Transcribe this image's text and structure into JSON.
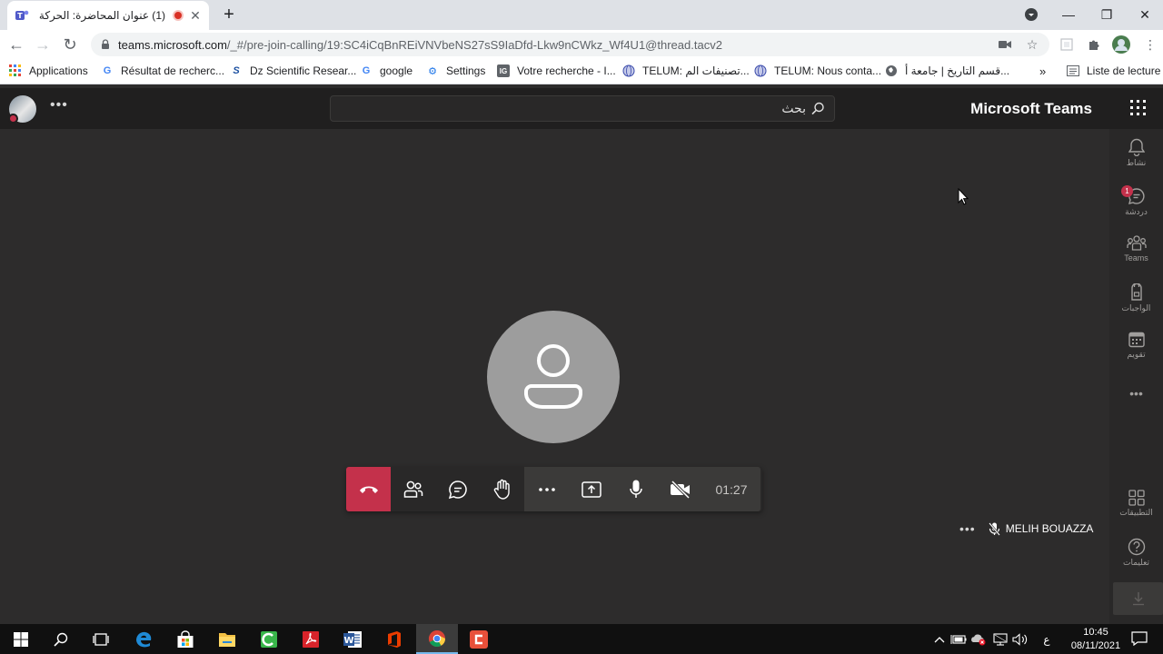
{
  "browser": {
    "tab": {
      "title": "(1) عنوان المحاضرة: الحركة الو"
    },
    "url": {
      "host": "teams.microsoft.com",
      "path": "/_#/pre-join-calling/19:SC4iCqBnREiVNVbeNS27sS9IaDfd-Lkw9nCWkz_Wf4U1@thread.tacv2"
    },
    "bookmarks": [
      {
        "label": "Applications",
        "icon": "apps-grid-icon"
      },
      {
        "label": "Résultat de recherc...",
        "icon": "google-icon"
      },
      {
        "label": "Dz Scientific Resear...",
        "icon": "asjp-icon"
      },
      {
        "label": "google",
        "icon": "google-icon"
      },
      {
        "label": "Settings",
        "icon": "gear-icon"
      },
      {
        "label": "Votre recherche - I...",
        "icon": "ig-icon"
      },
      {
        "label": "TELUM: تصنيفات الم...",
        "icon": "globe-icon"
      },
      {
        "label": "TELUM: Nous conta...",
        "icon": "globe-icon"
      },
      {
        "label": "قسم التاريخ | جامعة أ...",
        "icon": "globe-icon"
      }
    ],
    "reading_list": "Liste de lecture",
    "overflow": "»"
  },
  "teams": {
    "brand": "Microsoft Teams",
    "search_placeholder": "بحث",
    "rail": [
      {
        "label": "نشاط",
        "icon": "bell-icon"
      },
      {
        "label": "دردشة",
        "icon": "chat-icon",
        "badge": "1"
      },
      {
        "label": "Teams",
        "icon": "teams-icon"
      },
      {
        "label": "الواجبات",
        "icon": "backpack-icon"
      },
      {
        "label": "تقويم",
        "icon": "calendar-icon"
      },
      {
        "label": "التطبيقات",
        "icon": "apps-icon"
      },
      {
        "label": "تعليمات",
        "icon": "help-icon"
      }
    ],
    "call": {
      "timer": "01:27",
      "participant": "MELIH BOUAZZA"
    }
  },
  "taskbar": {
    "time": "10:45",
    "date": "08/11/2021",
    "lang": "ع"
  },
  "colors": {
    "hangup": "#c4314b",
    "stage": "#2d2c2c",
    "header": "#201f1f",
    "avatar_gray": "#9d9d9d"
  }
}
